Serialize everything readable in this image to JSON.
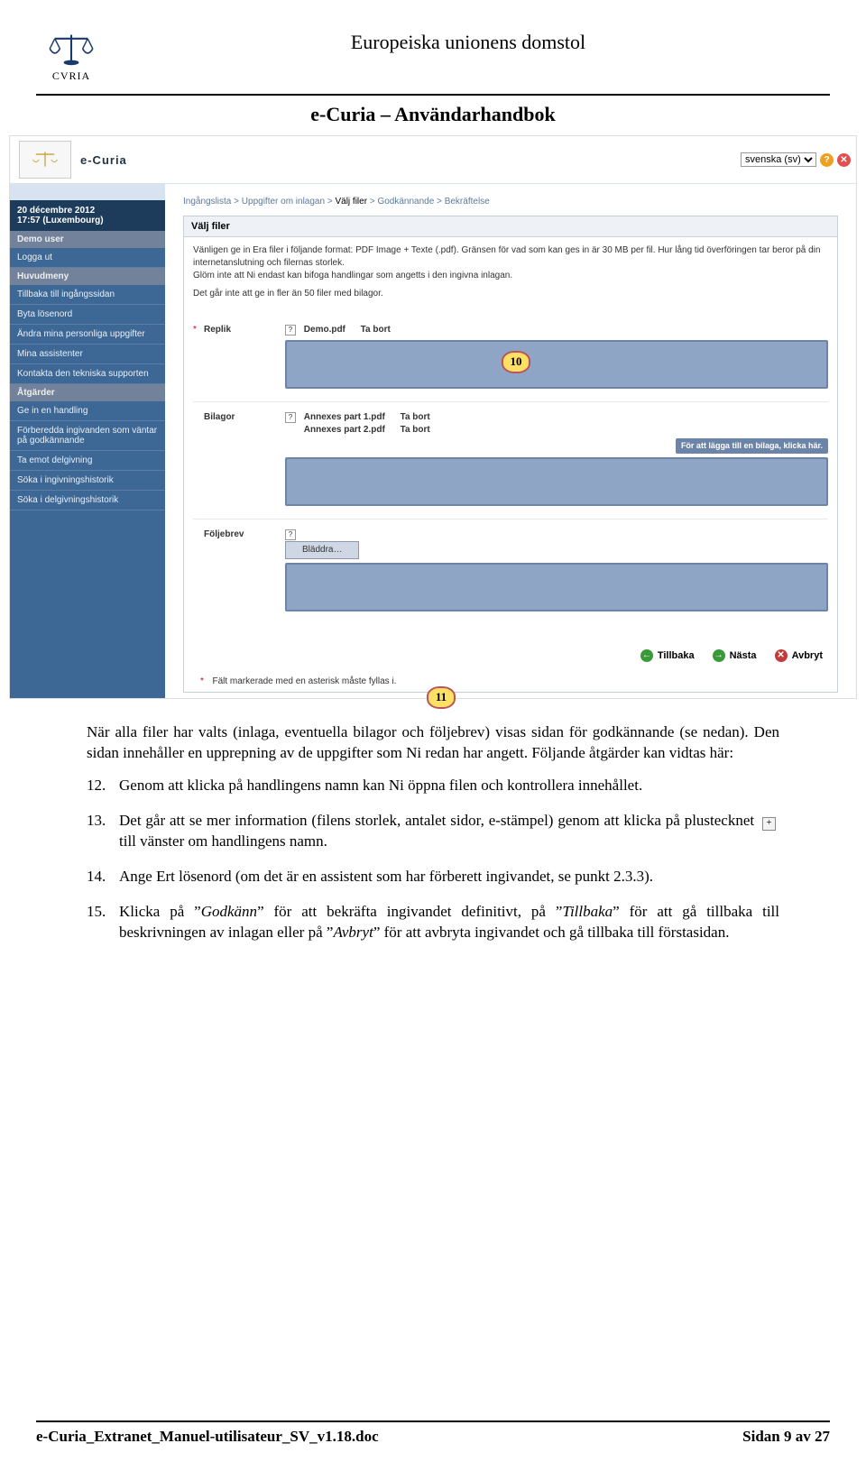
{
  "header": {
    "logo_caption": "CVRIA",
    "title": "Europeiska unionens domstol",
    "subtitle": "e-Curia – Användarhandbok"
  },
  "app": {
    "brand": "e-Curia",
    "language": "svenska (sv)",
    "date_line1": "20 décembre 2012",
    "date_line2": "17:57 (Luxembourg)",
    "user_section": "Demo user",
    "logout": "Logga ut",
    "menu_main_hdr": "Huvudmeny",
    "menu_main": [
      "Tillbaka till ingångssidan",
      "Byta lösenord",
      "Ändra mina personliga uppgifter",
      "Mina assistenter",
      "Kontakta den tekniska supporten"
    ],
    "menu_act_hdr": "Åtgärder",
    "menu_act": [
      "Ge in en handling",
      "Förberedda ingivanden som väntar på godkännande",
      "Ta emot delgivning",
      "Söka i ingivningshistorik",
      "Söka i delgivningshistorik"
    ],
    "crumbs": {
      "a": "Ingångslista",
      "b": "Uppgifter om inlagan",
      "c": "Välj filer",
      "d": "Godkännande",
      "e": "Bekräftelse"
    },
    "panel_title": "Välj filer",
    "panel_body_1": "Vänligen ge in Era filer i följande format: PDF Image + Texte (.pdf). Gränsen för vad som kan ges in är 30 MB per fil. Hur lång tid överföringen tar beror på din internetanslutning och filernas storlek.",
    "panel_body_2": "Glöm inte att Ni endast kan bifoga handlingar som angetts i den ingivna inlagan.",
    "panel_body_3": "Det går inte att ge in fler än 50 filer med bilagor.",
    "row_replik": "Replik",
    "replik_file": "Demo.pdf",
    "ta_bort": "Ta bort",
    "row_bilagor": "Bilagor",
    "bilaga1": "Annexes part 1.pdf",
    "bilaga2": "Annexes part 2.pdf",
    "add_more": "För att lägga till en bilaga, klicka här.",
    "row_foljebrev": "Följebrev",
    "browse": "Bläddra…",
    "btn_back": "Tillbaka",
    "btn_next": "Nästa",
    "btn_cancel": "Avbryt",
    "req_note": "Fält markerade med en asterisk måste fyllas i.",
    "callout_10": "10",
    "callout_11": "11"
  },
  "text": {
    "p1": "När alla filer har valts (inlaga, eventuella bilagor och följebrev) visas sidan för godkännande (se nedan). Den sidan innehåller en upprepning av de uppgifter som Ni redan har angett. Följande åtgärder kan vidtas här:",
    "items": [
      {
        "n": "12.",
        "t": "Genom att klicka på handlingens namn kan Ni öppna filen och kontrollera innehållet."
      },
      {
        "n": "13.",
        "t_before": "Det går att se mer information (filens storlek, antalet sidor, e-stämpel) genom att klicka på plustecknet",
        "t_after": "till vänster om handlingens namn."
      },
      {
        "n": "14.",
        "t": "Ange Ert lösenord (om det är en assistent som har förberett ingivandet, se punkt 2.3.3)."
      },
      {
        "n": "15.",
        "t_before": "Klicka på ”",
        "i1": "Godkänn",
        "t_mid1": "” för att bekräfta ingivandet definitivt, på ”",
        "i2": "Tillbaka",
        "t_mid2": "” för att gå tillbaka till beskrivningen av inlagan eller på ”",
        "i3": "Avbryt",
        "t_after": "” för att avbryta ingivandet och gå tillbaka till förstasidan."
      }
    ]
  },
  "footer": {
    "left": "e-Curia_Extranet_Manuel-utilisateur_SV_v1.18.doc",
    "right": "Sidan 9 av 27"
  }
}
